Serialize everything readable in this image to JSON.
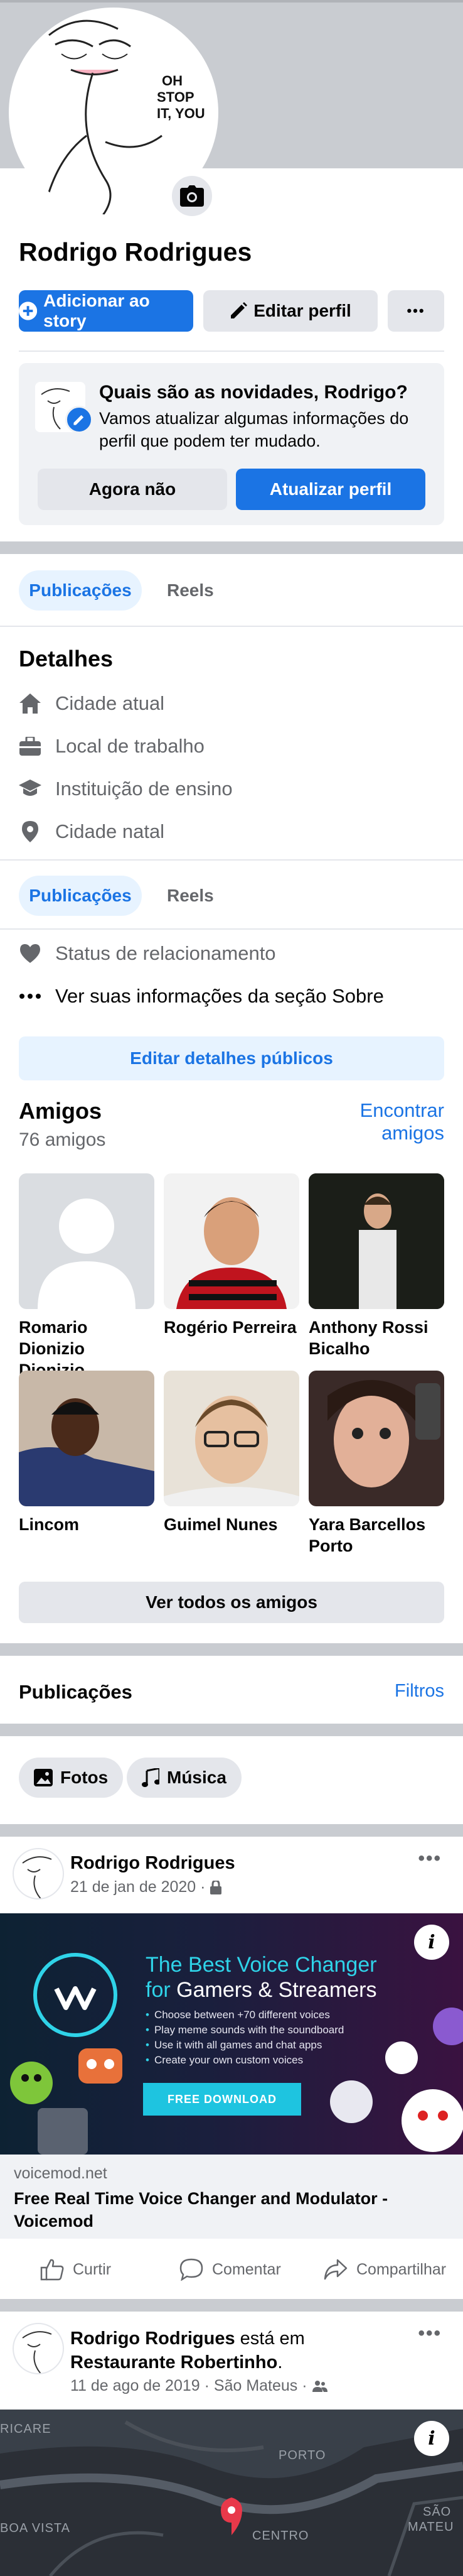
{
  "profile": {
    "name": "Rodrigo Rodrigues",
    "avatar_caption": "OH STOP IT, YOU",
    "add_story_label": "Adicionar ao story",
    "edit_profile_label": "Editar perfil",
    "more_label": "•••"
  },
  "update_card": {
    "title": "Quais são as novidades, Rodrigo?",
    "text": "Vamos atualizar algumas informações do perfil que podem ter mudado.",
    "not_now_label": "Agora não",
    "update_label": "Atualizar perfil"
  },
  "tabs": [
    {
      "label": "Publicações"
    },
    {
      "label": "Reels"
    }
  ],
  "details": {
    "title": "Detalhes",
    "items": [
      {
        "label": "Cidade atual",
        "icon": "home-icon"
      },
      {
        "label": "Local de trabalho",
        "icon": "briefcase-icon"
      },
      {
        "label": "Instituição de ensino",
        "icon": "graduation-cap-icon"
      },
      {
        "label": "Cidade natal",
        "icon": "location-pin-icon"
      }
    ],
    "relationship_label": "Status de relacionamento",
    "about_label": "Ver suas informações da seção Sobre",
    "edit_public_label": "Editar detalhes públicos"
  },
  "friends": {
    "title": "Amigos",
    "count": "76 amigos",
    "find_label_line1": "Encontrar",
    "find_label_line2": "amigos",
    "see_all_label": "Ver todos os amigos",
    "list": [
      {
        "name1": "Romario",
        "name2": "Dionizio Dionizio"
      },
      {
        "name1": "Rogério Perreira",
        "name2": ""
      },
      {
        "name1": "Anthony Rossi",
        "name2": "Bicalho"
      },
      {
        "name1": "Lincom",
        "name2": ""
      },
      {
        "name1": "Guimel Nunes",
        "name2": ""
      },
      {
        "name1": "Yara Barcellos",
        "name2": "Porto"
      }
    ]
  },
  "posts_section": {
    "title": "Publicações",
    "filters_label": "Filtros",
    "chip_photos": "Fotos",
    "chip_music": "Música"
  },
  "post1": {
    "author": "Rodrigo Rodrigues",
    "date": "21 de jan de 2020 ·",
    "ad": {
      "title_line1": "The Best Voice Changer",
      "title_for": "for",
      "title_line2": "Gamers & Streamers",
      "bullets": [
        "Choose between +70 different voices",
        "Play meme sounds with the soundboard",
        "Use it with all games and chat apps",
        "Create your own custom voices"
      ],
      "button": "FREE DOWNLOAD",
      "info": "i"
    },
    "link_domain": "voicemod.net",
    "link_title": "Free Real Time Voice Changer and Modulator - Voicemod",
    "like_label": "Curtir",
    "comment_label": "Comentar",
    "share_label": "Compartilhar"
  },
  "post2": {
    "author": "Rodrigo Rodrigues",
    "is_at": "está em",
    "place": "Restaurante Robertinho",
    "date": "11 de ago de 2019 · São Mateus ·",
    "map_labels": [
      "RICARE",
      "PORTO",
      "BOA VISTA",
      "CENTRO",
      "SÃO",
      "MATEU"
    ],
    "info": "i"
  },
  "colors": {
    "accent": "#1b74e4",
    "cover": "#c9ccd1",
    "light_blue": "#e7f3ff"
  }
}
